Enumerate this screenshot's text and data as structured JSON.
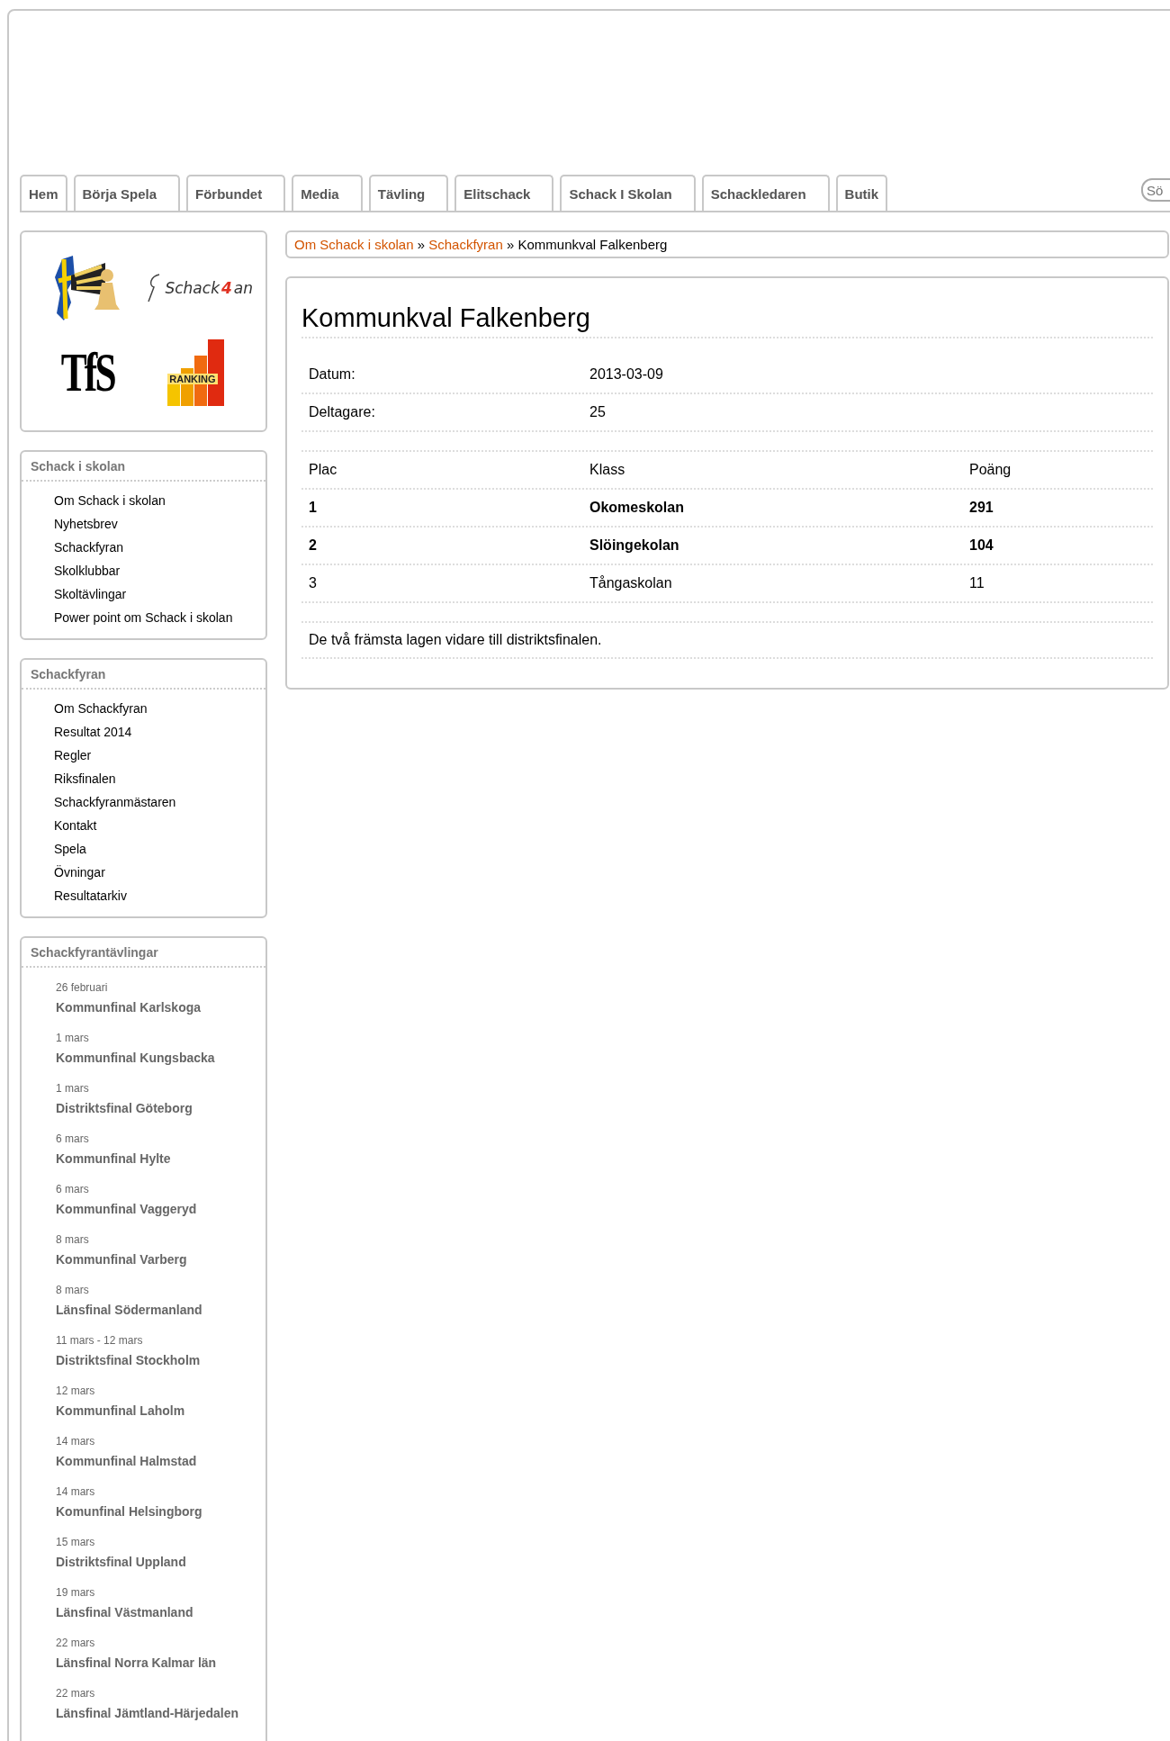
{
  "nav": {
    "tabs": [
      {
        "label": "Hem"
      },
      {
        "label": "Börja Spela"
      },
      {
        "label": "Förbundet"
      },
      {
        "label": "Media"
      },
      {
        "label": "Tävling"
      },
      {
        "label": "Elitschack"
      },
      {
        "label": "Schack I Skolan"
      },
      {
        "label": "Schackledaren"
      },
      {
        "label": "Butik"
      }
    ],
    "search": {
      "placeholder": "Sö"
    }
  },
  "sidebar": {
    "logos": [
      {
        "kind": "flag-pawn"
      },
      {
        "kind": "schack4an",
        "text": "Schack",
        "accent": "4",
        "suffix": "an"
      },
      {
        "kind": "tfs",
        "text": "TfS"
      },
      {
        "kind": "ranking",
        "text": "RANKING"
      }
    ],
    "menus": [
      {
        "title": "Schack i skolan",
        "items": [
          "Om Schack i skolan",
          "Nyhetsbrev",
          "Schackfyran",
          "Skolklubbar",
          "Skoltävlingar",
          "Power point om Schack i skolan"
        ]
      },
      {
        "title": "Schackfyran",
        "items": [
          "Om Schackfyran",
          "Resultat 2014",
          "Regler",
          "Riksfinalen",
          "Schackfyranmästaren",
          "Kontakt",
          "Spela",
          "Övningar",
          "Resultatarkiv"
        ]
      }
    ],
    "events": {
      "title": "Schackfyrantävlingar",
      "items": [
        {
          "date": "26 februari",
          "name": "Kommunfinal Karlskoga"
        },
        {
          "date": "1 mars",
          "name": "Kommunfinal Kungsbacka"
        },
        {
          "date": "1 mars",
          "name": "Distriktsfinal Göteborg"
        },
        {
          "date": "6 mars",
          "name": "Kommunfinal Hylte"
        },
        {
          "date": "6 mars",
          "name": "Kommunfinal Vaggeryd"
        },
        {
          "date": "8 mars",
          "name": "Kommunfinal Varberg"
        },
        {
          "date": "8 mars",
          "name": "Länsfinal Södermanland"
        },
        {
          "date": "11 mars - 12 mars",
          "name": "Distriktsfinal Stockholm"
        },
        {
          "date": "12 mars",
          "name": "Kommunfinal Laholm"
        },
        {
          "date": "14 mars",
          "name": "Kommunfinal Halmstad"
        },
        {
          "date": "14 mars",
          "name": "Komunfinal Helsingborg"
        },
        {
          "date": "15 mars",
          "name": "Distriktsfinal Uppland"
        },
        {
          "date": "19 mars",
          "name": "Länsfinal Västmanland"
        },
        {
          "date": "22 mars",
          "name": "Länsfinal Norra Kalmar län"
        },
        {
          "date": "22 mars",
          "name": "Länsfinal Jämtland-Härjedalen"
        }
      ]
    }
  },
  "breadcrumb": {
    "links": [
      "Om Schack i skolan",
      "Schackfyran"
    ],
    "separator": "»",
    "current": "Kommunkval Falkenberg"
  },
  "article": {
    "title": "Kommunkval Falkenberg",
    "info": [
      {
        "label": "Datum:",
        "value": "2013-03-09"
      },
      {
        "label": "Deltagare:",
        "value": "25"
      }
    ],
    "table": {
      "columns": [
        "Plac",
        "Klass",
        "Poäng"
      ],
      "rows": [
        {
          "cells": [
            "1",
            "Okomeskolan",
            "291"
          ],
          "bold": true
        },
        {
          "cells": [
            "2",
            "Slöingekolan",
            "104"
          ],
          "bold": true
        },
        {
          "cells": [
            "3",
            "Tångaskolan",
            "11"
          ],
          "bold": false
        }
      ]
    },
    "note": "De två främsta lagen vidare till distriktsfinalen."
  }
}
